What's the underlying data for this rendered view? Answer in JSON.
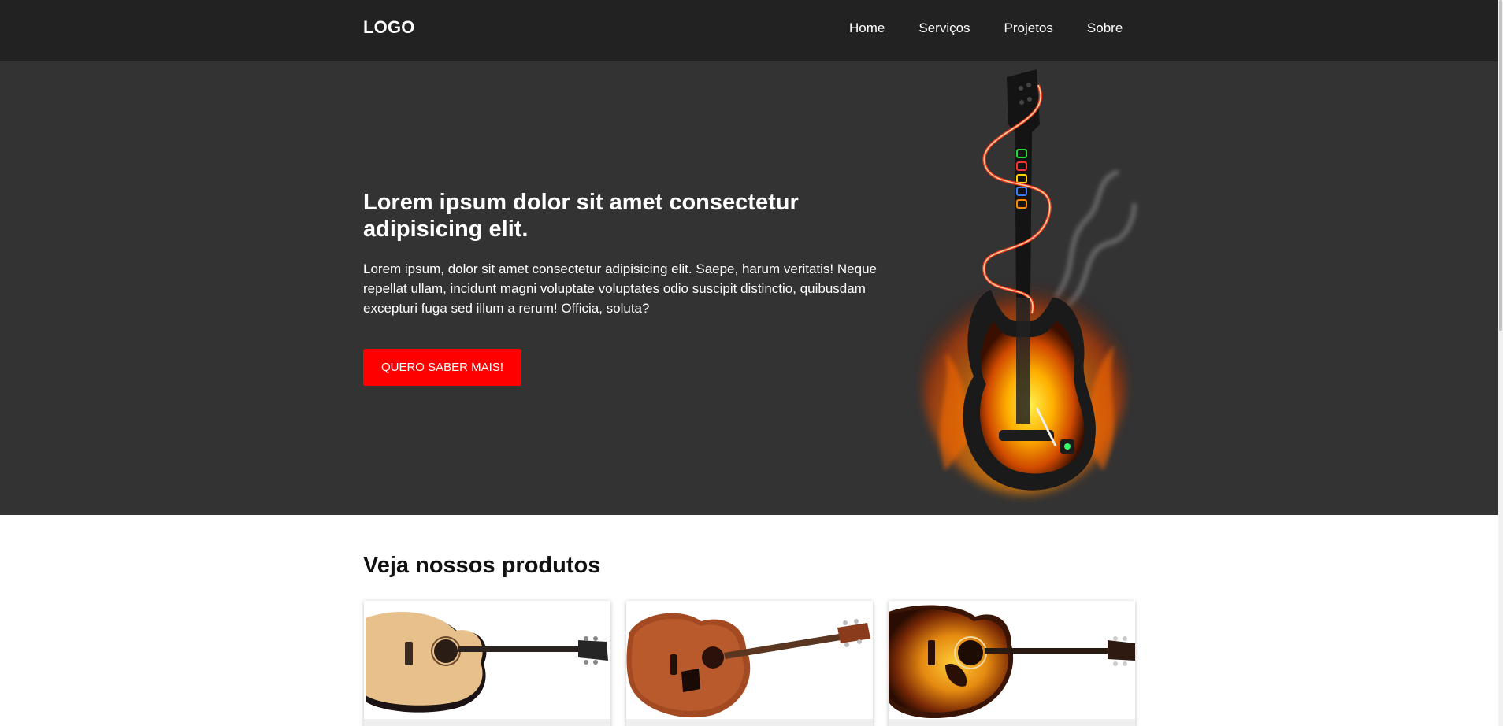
{
  "header": {
    "logo": "LOGO",
    "nav": [
      "Home",
      "Serviços",
      "Projetos",
      "Sobre"
    ]
  },
  "hero": {
    "title": "Lorem ipsum dolor sit amet consectetur adipisicing elit.",
    "text": "Lorem ipsum, dolor sit amet consectetur adipisicing elit. Saepe, harum veritatis! Neque repellat ullam, incidunt magni voluptate voluptates odio suscipit distinctio, quibusdam excepturi fuga sed illum a rerum! Officia, soluta?",
    "button": "QUERO SABER MAIS!",
    "image": "flaming-guitar-illustration"
  },
  "products": {
    "title": "Veja nossos produtos",
    "items": [
      {
        "image": "natural-acoustic-guitar"
      },
      {
        "image": "mahogany-acoustic-guitar"
      },
      {
        "image": "sunburst-acoustic-guitar"
      }
    ]
  },
  "colors": {
    "header_bg": "#222222",
    "hero_bg": "#333333",
    "accent": "#ff0000",
    "text_light": "#ffffff"
  }
}
